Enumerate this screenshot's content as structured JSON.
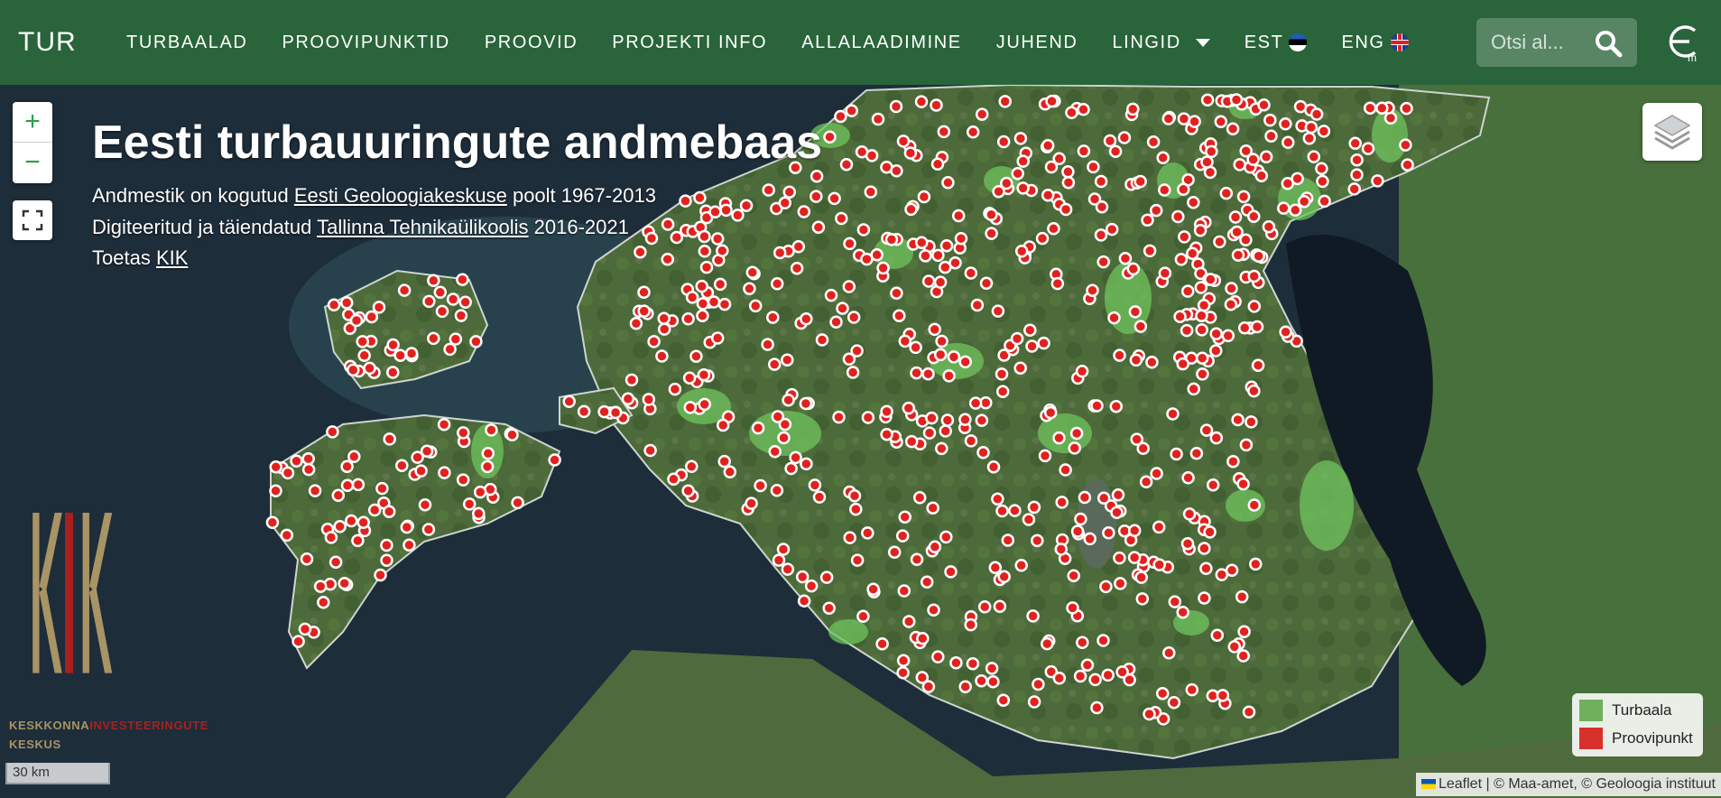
{
  "navbar": {
    "brand": "TUR",
    "items": [
      "TURBAALAD",
      "PROOVIPUNKTID",
      "PROOVID",
      "PROJEKTI INFO",
      "ALLALAADIMINE",
      "JUHEND"
    ],
    "dropdown_label": "LINGID",
    "lang_est": "EST",
    "lang_eng": "ENG",
    "search_placeholder": "Otsi al..."
  },
  "overlay": {
    "title": "Eesti turbauuringute andmebaas",
    "line1_prefix": "Andmestik on kogutud ",
    "line1_link": "Eesti Geoloogiakeskuse",
    "line1_suffix": " poolt 1967-2013",
    "line2_prefix": "Digiteeritud ja täiendatud ",
    "line2_link": "Tallinna Tehnikaülikoolis",
    "line2_suffix": " 2016-2021",
    "line3_prefix": "Toetas ",
    "line3_link": "KIK"
  },
  "controls": {
    "zoom_in": "+",
    "zoom_out": "−"
  },
  "kik": {
    "line1_a": "KESKKONNA",
    "line1_b": "INVESTEERINGUTE",
    "line2": "KESKUS"
  },
  "scale": {
    "label": "30 km"
  },
  "legend": {
    "items": [
      {
        "label": "Turbaala",
        "color": "#5fb04f"
      },
      {
        "label": "Proovipunkt",
        "color": "#d8302a"
      }
    ]
  },
  "attribution": {
    "leaflet": "Leaflet",
    "rest": " | © Maa-amet, © Geoloogia instituut"
  },
  "colors": {
    "navbar": "#2a683a",
    "point_fill": "#e0221e",
    "peat_area": "#6fc45e",
    "sea": "#1d2c3a",
    "land": "#4a5c38"
  }
}
